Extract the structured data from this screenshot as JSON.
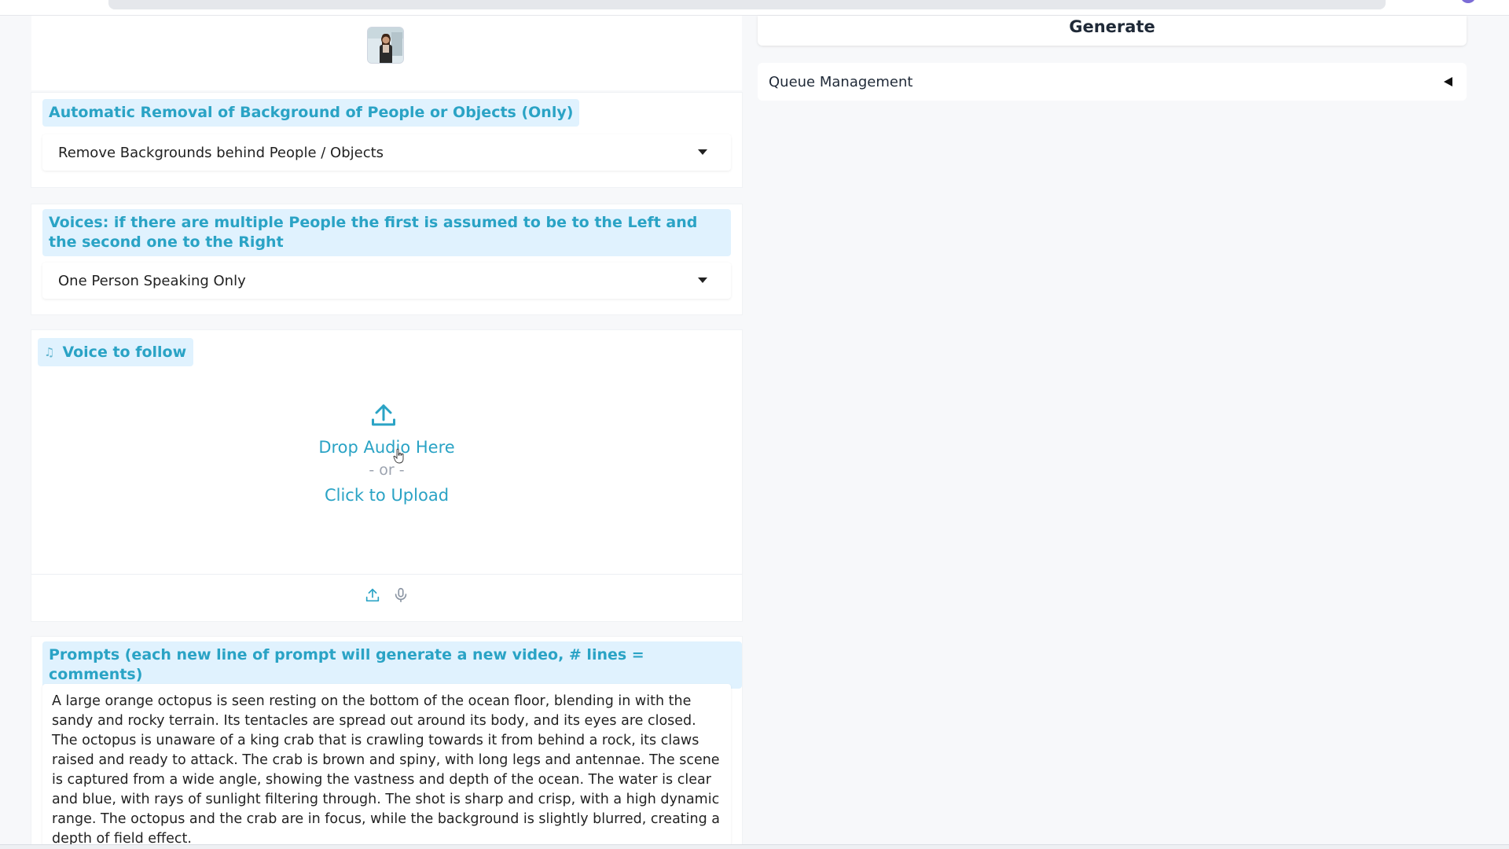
{
  "background_removal": {
    "label": "Automatic Removal of Background of People or Objects (Only)",
    "selected": "Remove Backgrounds behind People / Objects"
  },
  "voices": {
    "label": "Voices: if there are multiple People the first is assumed to be to the Left and the second one to the Right",
    "selected": "One Person Speaking Only"
  },
  "audio": {
    "label": "Voice to follow",
    "drop_text": "Drop Audio Here",
    "or_text": "- or -",
    "click_text": "Click to Upload"
  },
  "prompts": {
    "label": "Prompts (each new line of prompt will generate a new video, # lines = comments)",
    "text": "A large orange octopus is seen resting on the bottom of the ocean floor, blending in with the sandy and rocky terrain. Its tentacles are spread out around its body, and its eyes are closed. The octopus is unaware of a king crab that is crawling towards it from behind a rock, its claws raised and ready to attack. The crab is brown and spiny, with long legs and antennae. The scene is captured from a wide angle, showing the vastness and depth of the ocean. The water is clear and blue, with rays of sunlight filtering through. The shot is sharp and crisp, with a high dynamic range. The octopus and the crab are in focus, while the background is slightly blurred, creating a depth of field effect."
  },
  "generate": {
    "label": "Generate"
  },
  "queue": {
    "label": "Queue Management"
  },
  "colors": {
    "accent": "#2aa3c5",
    "label_bg": "#e0f2fe",
    "page_bg": "#f7f8fa"
  },
  "icons": {
    "audio_label": "music-note-icon",
    "upload": "upload-icon",
    "microphone": "microphone-icon",
    "dropdown": "caret-down-icon",
    "collapse": "triangle-left-icon"
  }
}
